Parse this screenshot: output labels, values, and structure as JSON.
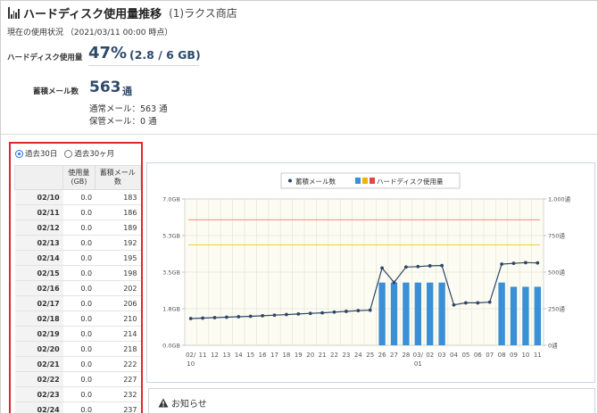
{
  "header": {
    "title": "ハードディスク使用量推移",
    "store": "(1)ラクス商店"
  },
  "status": {
    "current": "現在の使用状況 （2021/03/11 00:00 時点）",
    "disk_label": "ハードディスク使用量",
    "disk_percent": "47%",
    "disk_detail": "(2.8 / 6 GB)",
    "mail_label": "蓄積メール数",
    "mail_count": "563",
    "mail_unit": "通",
    "normal_mail": "通常メール：563 通",
    "archive_mail": "保管メール：0 通"
  },
  "period": {
    "option1": "過去30日",
    "option2": "過去30ヶ月",
    "selected": "option1"
  },
  "table": {
    "col_usage": "使用量(GB)",
    "col_mail": "蓄積メール数",
    "rows": [
      {
        "date": "02/10",
        "usage": "0.0",
        "mails": "183"
      },
      {
        "date": "02/11",
        "usage": "0.0",
        "mails": "186"
      },
      {
        "date": "02/12",
        "usage": "0.0",
        "mails": "189"
      },
      {
        "date": "02/13",
        "usage": "0.0",
        "mails": "192"
      },
      {
        "date": "02/14",
        "usage": "0.0",
        "mails": "195"
      },
      {
        "date": "02/15",
        "usage": "0.0",
        "mails": "198"
      },
      {
        "date": "02/16",
        "usage": "0.0",
        "mails": "202"
      },
      {
        "date": "02/17",
        "usage": "0.0",
        "mails": "206"
      },
      {
        "date": "02/18",
        "usage": "0.0",
        "mails": "210"
      },
      {
        "date": "02/19",
        "usage": "0.0",
        "mails": "214"
      },
      {
        "date": "02/20",
        "usage": "0.0",
        "mails": "218"
      },
      {
        "date": "02/21",
        "usage": "0.0",
        "mails": "222"
      },
      {
        "date": "02/22",
        "usage": "0.0",
        "mails": "227"
      },
      {
        "date": "02/23",
        "usage": "0.0",
        "mails": "232"
      },
      {
        "date": "02/24",
        "usage": "0.0",
        "mails": "237"
      }
    ]
  },
  "chart_data": {
    "type": "bar",
    "legend": {
      "line": "蓄積メール数",
      "bar": "ハードディスク使用量",
      "position": "top-center"
    },
    "categories": [
      "02/10",
      "11",
      "12",
      "13",
      "14",
      "15",
      "16",
      "17",
      "18",
      "19",
      "20",
      "21",
      "22",
      "23",
      "24",
      "25",
      "26",
      "27",
      "28",
      "03/01",
      "02",
      "03",
      "04",
      "05",
      "06",
      "07",
      "08",
      "09",
      "10",
      "11"
    ],
    "x_tick_labels": [
      "02/\n10",
      "11",
      "12",
      "13",
      "14",
      "15",
      "16",
      "17",
      "18",
      "19",
      "20",
      "21",
      "22",
      "23",
      "24",
      "25",
      "26",
      "27",
      "28",
      "03/\n01",
      "02",
      "03",
      "04",
      "05",
      "06",
      "07",
      "08",
      "09",
      "10",
      "11"
    ],
    "y_left": {
      "ticks": [
        "0.0GB",
        "1.8GB",
        "3.5GB",
        "5.3GB",
        "7.0GB"
      ],
      "max": 7.0
    },
    "y_right": {
      "ticks": [
        "0通",
        "250通",
        "500通",
        "750通",
        "1,000通"
      ],
      "max": 1000
    },
    "disk_gb": [
      0,
      0,
      0,
      0,
      0,
      0,
      0,
      0,
      0,
      0,
      0,
      0,
      0,
      0,
      0,
      0,
      3.0,
      3.0,
      3.0,
      3.0,
      3.0,
      3.0,
      0,
      0,
      0,
      0,
      3.0,
      2.8,
      2.8,
      2.8
    ],
    "mail_count": [
      183,
      186,
      189,
      192,
      195,
      198,
      202,
      206,
      210,
      214,
      218,
      222,
      227,
      232,
      237,
      240,
      528,
      430,
      535,
      538,
      543,
      545,
      276,
      290,
      290,
      295,
      555,
      560,
      565,
      563
    ],
    "ref_lines_gb": [
      {
        "value": 6.0,
        "color": "#f08a7e"
      },
      {
        "value": 4.8,
        "color": "#f0c94a"
      }
    ],
    "colors": {
      "bar": "#3a8fd6",
      "line": "#2e4766",
      "legend_yellow": "#f0b400",
      "legend_red": "#e0483a"
    },
    "grid": true
  },
  "notice": {
    "label": "お知らせ"
  }
}
